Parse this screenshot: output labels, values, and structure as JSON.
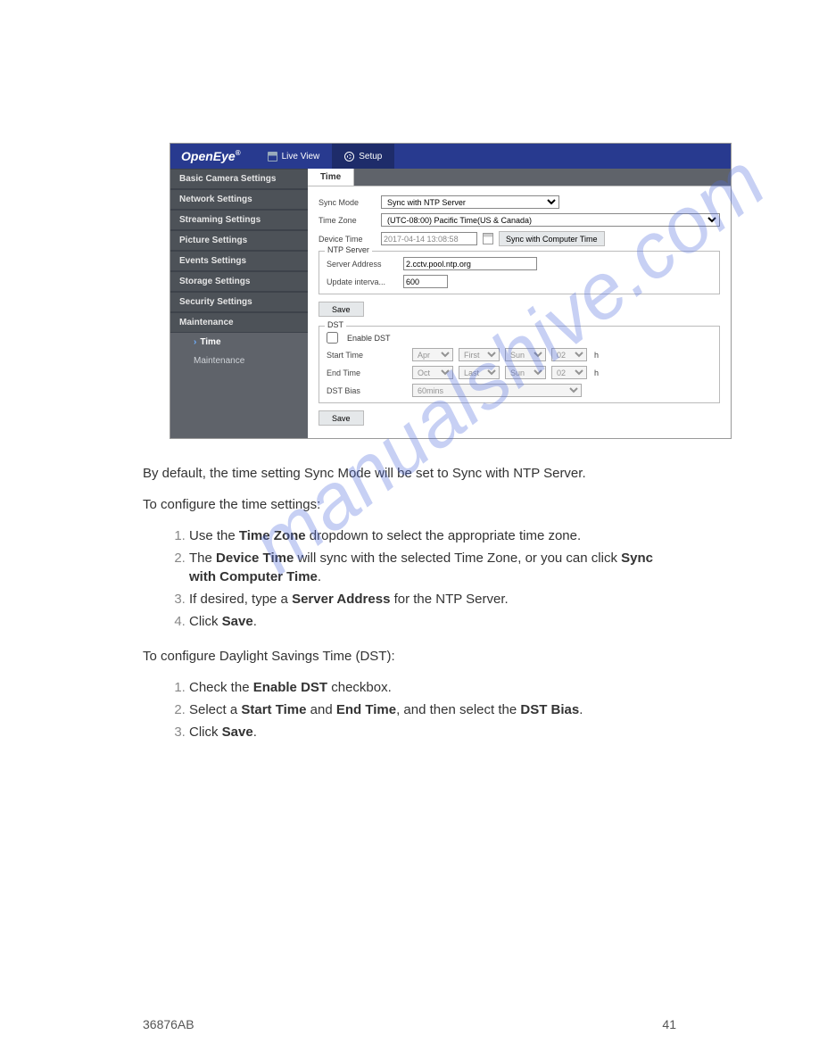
{
  "watermark": "manualshive.com",
  "footer": {
    "docid": "36876AB",
    "page": "41"
  },
  "app": {
    "brand": "OpenEye",
    "top": {
      "live": "Live View",
      "setup": "Setup"
    },
    "sidebar": [
      "Basic Camera Settings",
      "Network Settings",
      "Streaming Settings",
      "Picture Settings",
      "Events Settings",
      "Storage Settings",
      "Security Settings",
      "Maintenance"
    ],
    "subitems": {
      "time": "Time",
      "maintenance": "Maintenance"
    },
    "tab": "Time",
    "form": {
      "syncModeLabel": "Sync Mode",
      "syncMode": "Sync with NTP Server",
      "timeZoneLabel": "Time Zone",
      "timeZone": "(UTC-08:00) Pacific Time(US & Canada)",
      "deviceTimeLabel": "Device Time",
      "deviceTime": "2017-04-14 13:08:58",
      "syncComputerBtn": "Sync with Computer Time",
      "ntpLegend": "NTP Server",
      "serverAddressLabel": "Server Address",
      "serverAddress": "2.cctv.pool.ntp.org",
      "updateIntervalLabel": "Update interva...",
      "updateInterval": "600",
      "save": "Save",
      "dstLegend": "DST",
      "enableDST": "Enable DST",
      "startTimeLabel": "Start Time",
      "start": {
        "month": "Apr",
        "week": "First",
        "day": "Sun",
        "hour": "02"
      },
      "endTimeLabel": "End Time",
      "end": {
        "month": "Oct",
        "week": "Last",
        "day": "Sun",
        "hour": "02"
      },
      "h": "h",
      "dstBiasLabel": "DST Bias",
      "dstBias": "60mins"
    }
  },
  "doc": {
    "p1": "By default, the time setting Sync Mode will be set to Sync with NTP Server.",
    "p2": "To configure the time settings:",
    "li1a": "Use the ",
    "li1b": "Time Zone",
    "li1c": " dropdown to select the appropriate time zone.",
    "li2a": "The ",
    "li2b": "Device Time",
    "li2c": " will sync with the selected Time Zone, or you can click ",
    "li2d": "Sync with Computer Time",
    "li2e": ".",
    "li3a": "If desired, type a ",
    "li3b": "Server Address",
    "li3c": " for the NTP Server.",
    "li4a": "Click ",
    "li4b": "Save",
    "li4c": ".",
    "p3": "To configure Daylight Savings Time (DST):",
    "li5a": "Check the ",
    "li5b": "Enable DST",
    "li5c": " checkbox.",
    "li6a": "Select a ",
    "li6b": "Start Time",
    "li6c": " and ",
    "li6d": "End Time",
    "li6e": ", and then select the ",
    "li6f": "DST Bias",
    "li6g": ".",
    "li7a": "Click ",
    "li7b": "Save",
    "li7c": "."
  }
}
